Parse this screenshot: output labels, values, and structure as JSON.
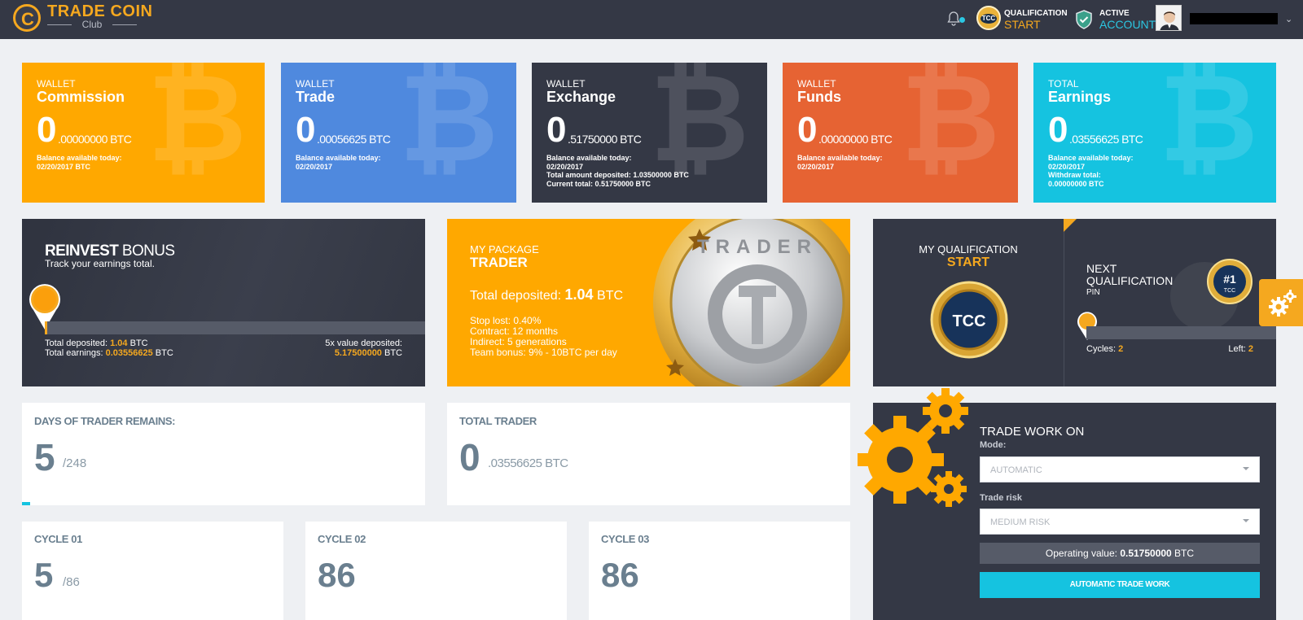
{
  "header": {
    "logo_title": "TRADE COIN",
    "logo_sub": "Club",
    "logo_letter": "C",
    "qual_badge": "TCC",
    "qual_label": "QUALIFICATION",
    "qual_value": "START",
    "account_label": "ACTIVE",
    "account_value": "ACCOUNT",
    "caret": "⌄"
  },
  "btc_glyph": "₿",
  "wallets": [
    {
      "caption": "WALLET",
      "title": "Commission",
      "big": "0",
      "small": ".00000000 BTC",
      "line1": "Balance available today:",
      "line2": "02/20/2017 BTC",
      "line3": "",
      "line4": "",
      "color": "#ffa800"
    },
    {
      "caption": "WALLET",
      "title": "Trade",
      "big": "0",
      "small": ".00056625 BTC",
      "line1": "Balance available today:",
      "line2": "02/20/2017",
      "line3": "",
      "line4": "",
      "color": "#4f89de"
    },
    {
      "caption": "WALLET",
      "title": "Exchange",
      "big": "0",
      "small": ".51750000 BTC",
      "line1": "Balance available today:",
      "line2": "02/20/2017",
      "line3": "Total amount deposited: 1.03500000 BTC",
      "line4": "Current total: 0.51750000 BTC",
      "color": "#343845"
    },
    {
      "caption": "WALLET",
      "title": "Funds",
      "big": "0",
      "small": ".00000000 BTC",
      "line1": "Balance available today:",
      "line2": "02/20/2017",
      "line3": "",
      "line4": "",
      "color": "#e66333"
    },
    {
      "caption": "TOTAL",
      "title": "Earnings",
      "big": "0",
      "small": ".03556625 BTC",
      "line1": "Balance available today:",
      "line2": "02/20/2017",
      "line3": "Withdraw total:",
      "line4": "0.00000000 BTC",
      "color": "#15c3e0"
    }
  ],
  "reinvest": {
    "title_bold": "REINVEST",
    "title_rest": " BONUS",
    "subtitle": "Track your earnings total.",
    "deposited_label": "Total deposited: ",
    "deposited_value": "1.04",
    "deposited_unit": " BTC",
    "earnings_label": "Total earnings: ",
    "earnings_value": "0.03556625",
    "earnings_unit": " BTC",
    "fivex_label": "5x value deposited:",
    "fivex_value": "5.17500000",
    "fivex_unit": " BTC",
    "progress": 0.007
  },
  "package": {
    "caption": "MY PACKAGE",
    "title": "TRADER",
    "deposited_label": "Total deposited: ",
    "deposited_value": "1.04",
    "deposited_unit": " BTC",
    "lines": [
      "Stop lost: 0.40%",
      "Contract: 12 months",
      "Indirect: 5 generations",
      "Team bonus: 9% - 10BTC per day"
    ],
    "coin_text": "TRADER"
  },
  "qualification": {
    "my_label": "MY QUALIFICATION",
    "my_value": "START",
    "badge": "TCC",
    "next_label_1": "NEXT",
    "next_label_2": "QUALIFICATION",
    "next_sub": "PIN",
    "pin_badge_top": "#1",
    "pin_badge_bottom": "TCC",
    "cycles_label": "Cycles: ",
    "cycles_value": "2",
    "left_label": "Left: ",
    "left_value": "2",
    "progress": 0.0
  },
  "days": {
    "label": "DAYS OF TRADER REMAINS:",
    "value": "5",
    "total": "/248",
    "progress": 0.02
  },
  "total_trader": {
    "label": "TOTAL TRADER",
    "value": "0",
    "decimal": ".03556625 BTC"
  },
  "cycles": [
    {
      "label": "CYCLE 01",
      "value": "5",
      "total": "/86"
    },
    {
      "label": "CYCLE 02",
      "value": "86",
      "total": ""
    },
    {
      "label": "CYCLE 03",
      "value": "86",
      "total": ""
    }
  ],
  "trade_work": {
    "title": "TRADE WORK ON",
    "mode_label": "Mode:",
    "mode_value": "AUTOMATIC",
    "risk_label": "Trade risk",
    "risk_value": "MEDIUM RISK",
    "operating_label": "Operating value: ",
    "operating_value": "0.51750000",
    "operating_unit": " BTC",
    "button": "AUTOMATIC TRADE WORK"
  },
  "colors": {
    "accent": "#f5a81f",
    "cyan": "#15c3e0",
    "dark": "#343845"
  }
}
